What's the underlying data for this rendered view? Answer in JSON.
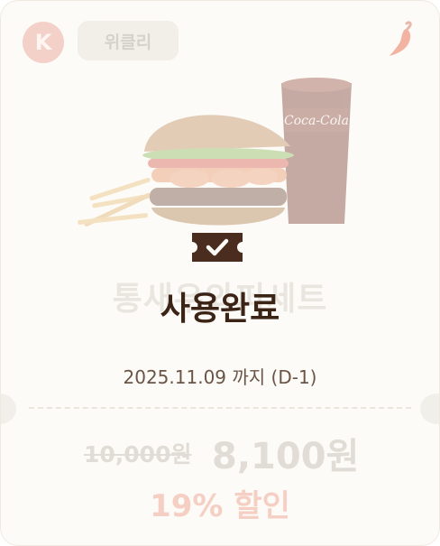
{
  "brand": {
    "initial": "K",
    "accent_color": "#f3d1c9"
  },
  "tag": {
    "label": "위클리"
  },
  "product": {
    "name": "통새우와퍼세트"
  },
  "status": {
    "label": "사용완료"
  },
  "expiry": {
    "text": "2025.11.09 까지  (D-1)"
  },
  "price": {
    "original": "10,000원",
    "sale": "8,100원",
    "discount": "19% 할인"
  },
  "icons": {
    "spicy": "chili-pepper-icon",
    "used": "ticket-check-icon"
  }
}
